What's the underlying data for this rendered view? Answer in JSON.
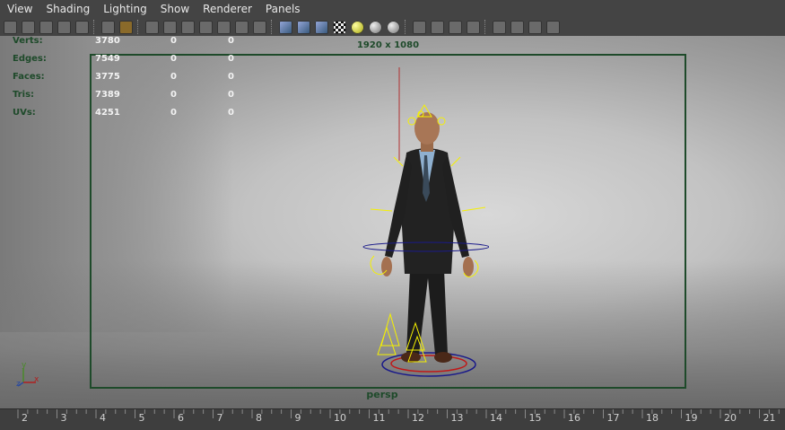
{
  "menu": [
    "View",
    "Shading",
    "Lighting",
    "Show",
    "Renderer",
    "Panels"
  ],
  "toolbar_icons": [
    "select-camera-icon",
    "lock-camera-icon",
    "camera-attributes-icon",
    "bookmark-icon",
    "image-plane-icon",
    "two-d-pan-zoom-icon",
    "grease-pencil-icon",
    "grid-icon",
    "film-gate-icon",
    "resolution-gate-icon",
    "gate-mask-icon",
    "field-chart-icon",
    "safe-action-icon",
    "safe-title-icon",
    "wireframe-icon",
    "smooth-shade-icon",
    "wireframe-on-shaded-icon",
    "textured-icon",
    "use-all-lights-icon",
    "shadows-icon",
    "screen-space-ao-icon",
    "motion-blur-icon",
    "multisample-aa-icon",
    "depth-of-field-icon",
    "isolate-select-icon",
    "xray-icon",
    "xray-joints-icon",
    "backface-culling-icon",
    "hierarchy-icon"
  ],
  "viewport": {
    "resolution": "1920 x 1080",
    "camera": "persp",
    "colors": {
      "gate": "#1e4a2a",
      "wire": "#f5f000",
      "root": "#c01818",
      "ring": "#1a1a8a"
    }
  },
  "stats": [
    {
      "label": "Verts:",
      "v1": "3780",
      "v2": "0",
      "v3": "0"
    },
    {
      "label": "Edges:",
      "v1": "7549",
      "v2": "0",
      "v3": "0"
    },
    {
      "label": "Faces:",
      "v1": "3775",
      "v2": "0",
      "v3": "0"
    },
    {
      "label": "Tris:",
      "v1": "7389",
      "v2": "0",
      "v3": "0"
    },
    {
      "label": "UVs:",
      "v1": "4251",
      "v2": "0",
      "v3": "0"
    }
  ],
  "axis": {
    "y": "y",
    "z": "z",
    "x": "x"
  },
  "timeline": {
    "labels": [
      "2",
      "3",
      "4",
      "5",
      "6",
      "7",
      "8",
      "9",
      "10",
      "11",
      "12",
      "13",
      "14",
      "15",
      "16",
      "17",
      "18",
      "19",
      "20",
      "21"
    ]
  }
}
